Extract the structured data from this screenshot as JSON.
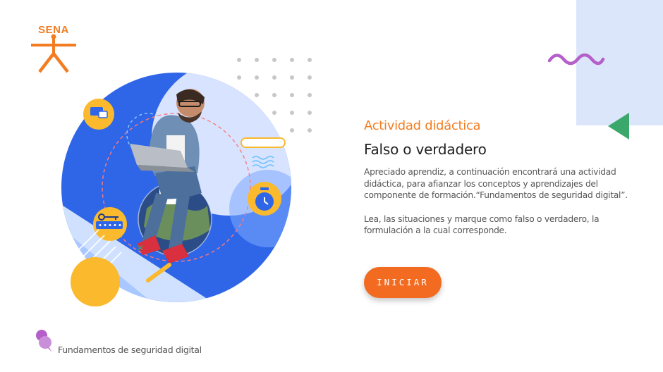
{
  "brand": {
    "logo_text": "SENA",
    "color": "#f47c20"
  },
  "activity": {
    "eyebrow": "Actividad didáctica",
    "title": "Falso o verdadero",
    "intro": "Apreciado aprendiz, a continuación encontrará una actividad didáctica, para afianzar los conceptos y aprendizajes del componente de formación.“Fundamentos de seguridad digital”.",
    "instruction": "Lea, las situaciones y marque como falso o verdadero, la formulación a la cual corresponde.",
    "start_label": "INICIAR"
  },
  "footer": {
    "course_name": "Fundamentos de seguridad digital"
  },
  "colors": {
    "accent": "#f26b21",
    "circle_blue": "#2f66e8",
    "light_blue": "#dce6fb",
    "yellow": "#fbb92d",
    "purple": "#b55fc8",
    "green": "#3aa86b"
  },
  "icons": [
    "sena-logo-icon",
    "wave-decoration-icon",
    "triangle-decoration-icon",
    "dots-grid-icon",
    "devices-icon",
    "key-password-icon",
    "clock-icon",
    "course-badge-icon"
  ]
}
